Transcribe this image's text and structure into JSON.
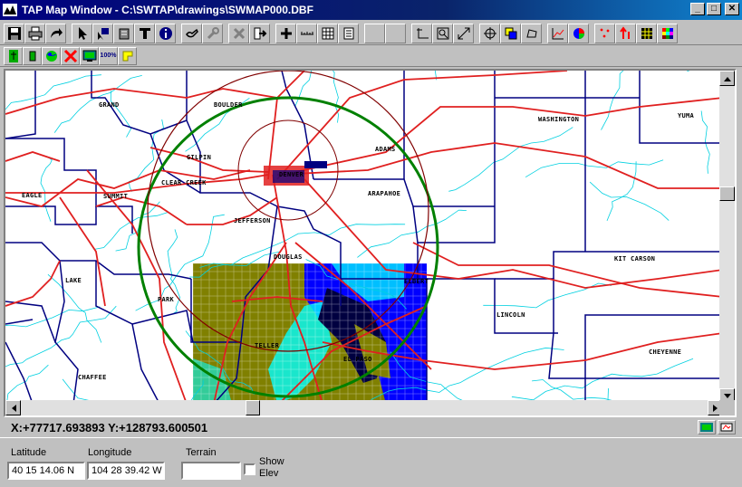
{
  "window": {
    "title": "TAP Map Window - C:\\SWTAP\\drawings\\SWMAP000.DBF",
    "minimize_glyph": "_",
    "maximize_glyph": "□",
    "close_glyph": "✕"
  },
  "toolbar2": {
    "zoom100_label": "100%"
  },
  "map": {
    "labels": [
      {
        "text": "GRAND"
      },
      {
        "text": "BOULDER"
      },
      {
        "text": "WASHINGTON"
      },
      {
        "text": "YUMA"
      },
      {
        "text": "GILPIN"
      },
      {
        "text": "ADAMS"
      },
      {
        "text": "DENVER"
      },
      {
        "text": "EAGLE"
      },
      {
        "text": "SUMMIT"
      },
      {
        "text": "CLEAR CREEK"
      },
      {
        "text": "ARAPAHOE"
      },
      {
        "text": "JEFFERSON"
      },
      {
        "text": "DOUGLAS"
      },
      {
        "text": "KIT CARSON"
      },
      {
        "text": "LAKE"
      },
      {
        "text": "PARK"
      },
      {
        "text": "ELBERT"
      },
      {
        "text": "LINCOLN"
      },
      {
        "text": "TELLER"
      },
      {
        "text": "CHEYENNE"
      },
      {
        "text": "EL PASO"
      },
      {
        "text": "CHAFFEE"
      }
    ]
  },
  "coords": {
    "text": "X:+77717.693893 Y:+128793.600501"
  },
  "status": {
    "latitude_label": "Latitude",
    "latitude_value": "40 15 14.06 N",
    "longitude_label": "Longitude",
    "longitude_value": "104 28 39.42 W",
    "terrain_label": "Terrain",
    "terrain_value": "",
    "show_elev_label_1": "Show",
    "show_elev_label_2": "Elev"
  },
  "colors": {
    "county": "#000080",
    "road": "#e02020",
    "river": "#00d0e0",
    "outer_ring": "#008000",
    "inner_ring": "#800000",
    "terrain_olive": "#808000",
    "terrain_blue": "#0000ff",
    "terrain_cyan": "#00ffff"
  },
  "icons": [
    "save-icon",
    "print-icon",
    "redo-icon",
    "arrow-icon",
    "select-icon",
    "erase-icon",
    "text-icon",
    "info-icon",
    "hand-icon",
    "tools-icon",
    "delete-icon",
    "export-icon",
    "plus-icon",
    "ruler-icon",
    "grid-icon",
    "page-icon",
    "axis-icon",
    "zoom-box-icon",
    "zoom-out-icon",
    "target-icon",
    "layers-icon",
    "lasso-icon",
    "chart-icon",
    "pie-icon",
    "points-icon",
    "arrows-icon",
    "palette-grid-icon",
    "color-grid-icon"
  ]
}
